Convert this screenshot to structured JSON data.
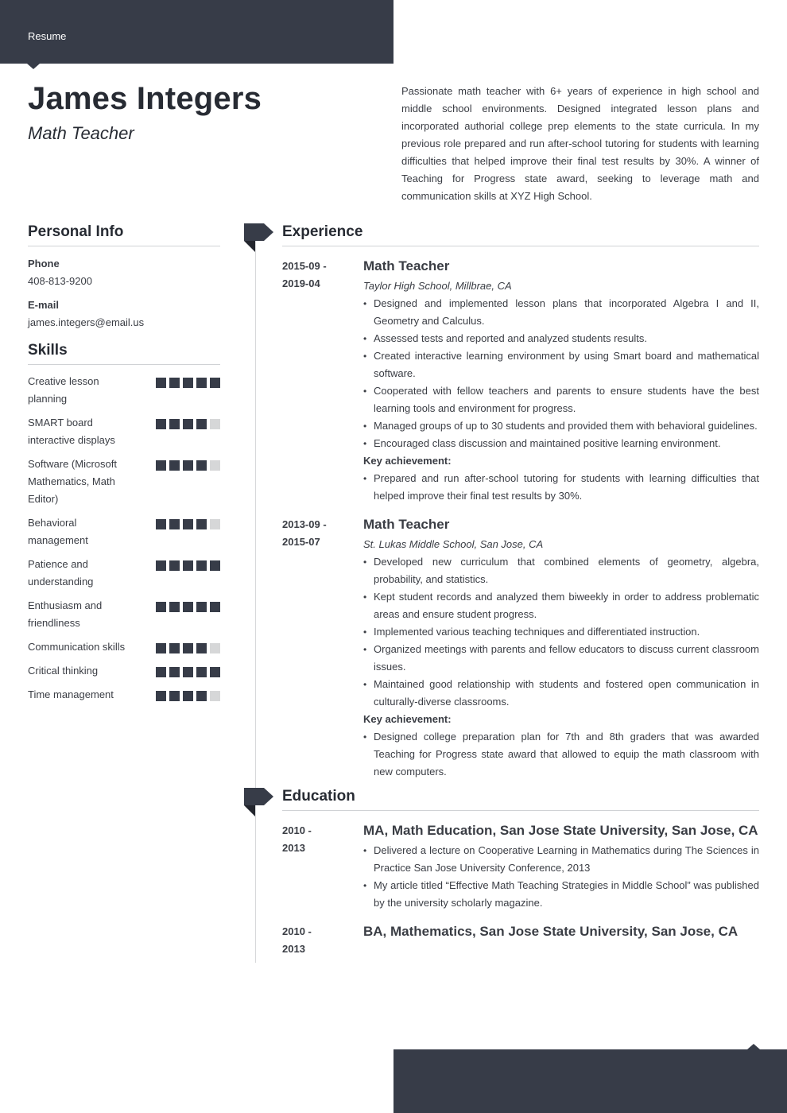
{
  "header": {
    "label": "Resume"
  },
  "profile": {
    "name": "James Integers",
    "role": "Math Teacher",
    "summary": "Passionate math teacher with 6+ years of experience in high school and middle school environments. Designed integrated lesson plans and incorporated authorial college prep elements to the state curricula. In my previous role prepared and run after-school tutoring for students with learning difficulties that helped improve their final test results by 30%. A winner of Teaching for Progress state award, seeking to leverage math and communication skills at XYZ High School."
  },
  "personal_info": {
    "title": "Personal Info",
    "phone_label": "Phone",
    "phone": "408-813-9200",
    "email_label": "E-mail",
    "email": "james.integers@email.us"
  },
  "skills": {
    "title": "Skills",
    "max_level": 5,
    "items": [
      {
        "name": "Creative lesson planning",
        "level": 5
      },
      {
        "name": "SMART board interactive displays",
        "level": 4
      },
      {
        "name": "Software (Microsoft Mathematics, Math Editor)",
        "level": 4
      },
      {
        "name": "Behavioral management",
        "level": 4
      },
      {
        "name": "Patience and understanding",
        "level": 5
      },
      {
        "name": "Enthusiasm and friendliness",
        "level": 5
      },
      {
        "name": "Communication skills",
        "level": 4
      },
      {
        "name": "Critical thinking",
        "level": 5
      },
      {
        "name": "Time management",
        "level": 4
      }
    ]
  },
  "experience": {
    "title": "Experience",
    "entries": [
      {
        "date_start": "2015-09 -",
        "date_end": "2019-04",
        "title": "Math Teacher",
        "subtitle": "Taylor High School, Millbrae, CA",
        "bullets": [
          "Designed and implemented lesson plans that incorporated Algebra I and II, Geometry and Calculus.",
          "Assessed tests and reported and analyzed students results.",
          "Created interactive learning environment by using Smart board and mathematical software.",
          "Cooperated with fellow teachers and parents to ensure students have the best learning tools and environment for progress.",
          "Managed groups of up to 30 students and provided them with behavioral guidelines.",
          "Encouraged class discussion and maintained positive learning environment."
        ],
        "key_label": "Key achievement:",
        "key_bullets": [
          "Prepared and run after-school tutoring for students with learning difficulties that helped improve their final test results by 30%."
        ]
      },
      {
        "date_start": "2013-09 -",
        "date_end": "2015-07",
        "title": "Math Teacher",
        "subtitle": "St. Lukas Middle School, San Jose, CA",
        "bullets": [
          "Developed new curriculum that combined elements of geometry, algebra, probability, and statistics.",
          "Kept student records and analyzed them biweekly in order to address problematic areas and ensure student progress.",
          "Implemented various teaching techniques and differentiated instruction.",
          "Organized meetings with parents and fellow educators to discuss current classroom issues.",
          "Maintained good relationship with students and fostered open communication in culturally-diverse classrooms."
        ],
        "key_label": "Key achievement:",
        "key_bullets": [
          "Designed college preparation plan for 7th and 8th graders that was awarded Teaching for Progress state award that allowed to equip the math classroom with new computers."
        ]
      }
    ]
  },
  "education": {
    "title": "Education",
    "entries": [
      {
        "date_start": "2010 -",
        "date_end": "2013",
        "title": "MA, Math Education, San Jose State University, San Jose, CA",
        "bullets": [
          "Delivered a lecture on Cooperative Learning in Mathematics during The Sciences in Practice San Jose University Conference, 2013",
          "My article titled “Effective Math Teaching Strategies in Middle School” was published by the university scholarly magazine."
        ]
      },
      {
        "date_start": "2010 -",
        "date_end": "2013",
        "title": "BA, Mathematics, San Jose State University, San Jose, CA",
        "bullets": []
      }
    ]
  },
  "colors": {
    "accent": "#373c48",
    "text": "#3a3d44",
    "heading": "#272b33",
    "rule": "#d0d2d5",
    "skill_off": "#d6d7d8"
  }
}
